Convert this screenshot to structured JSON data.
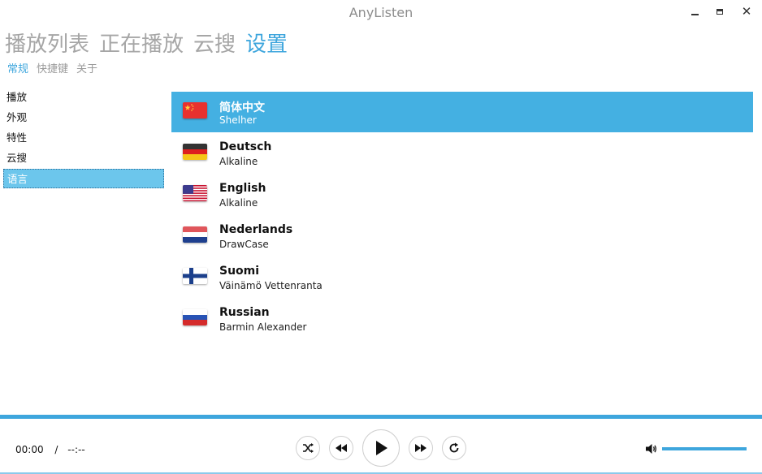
{
  "window": {
    "title": "AnyListen"
  },
  "main_tabs": [
    {
      "label": "播放列表",
      "active": false
    },
    {
      "label": "正在播放",
      "active": false
    },
    {
      "label": "云搜",
      "active": false
    },
    {
      "label": "设置",
      "active": true
    }
  ],
  "sub_tabs": [
    {
      "label": "常规",
      "active": true
    },
    {
      "label": "快捷键",
      "active": false
    },
    {
      "label": "关于",
      "active": false
    }
  ],
  "side_nav": [
    {
      "label": "播放",
      "active": false
    },
    {
      "label": "外观",
      "active": false
    },
    {
      "label": "特性",
      "active": false
    },
    {
      "label": "云搜",
      "active": false
    },
    {
      "label": "语言",
      "active": true
    }
  ],
  "languages": [
    {
      "name": "简体中文",
      "author": "Shelher",
      "flag": "cn-flag-icon",
      "selected": true
    },
    {
      "name": "Deutsch",
      "author": "Alkaline",
      "flag": "de-flag-icon",
      "selected": false
    },
    {
      "name": "English",
      "author": "Alkaline",
      "flag": "us-flag-icon",
      "selected": false
    },
    {
      "name": "Nederlands",
      "author": "DrawCase",
      "flag": "nl-flag-icon",
      "selected": false
    },
    {
      "name": "Suomi",
      "author": "Väinämö Vettenranta",
      "flag": "fi-flag-icon",
      "selected": false
    },
    {
      "name": "Russian",
      "author": "Barmin Alexander",
      "flag": "ru-flag-icon",
      "selected": false
    }
  ],
  "player": {
    "current_time": "00:00",
    "separator": "/",
    "total_time": "--:--",
    "volume": 1.0
  },
  "colors": {
    "accent": "#3ea6dd",
    "selected_row": "#44b0e2",
    "inactive_tab": "#a6a6a6"
  }
}
